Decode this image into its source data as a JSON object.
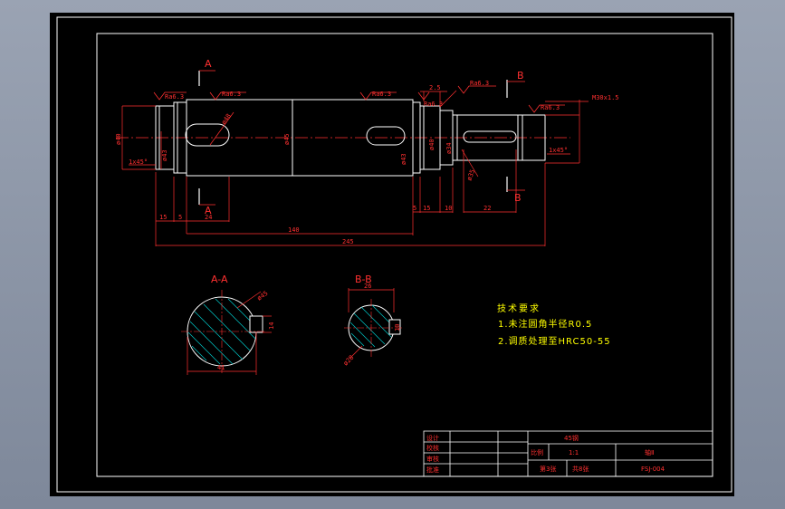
{
  "colors": {
    "background": "#000000",
    "frame": "#ffffff",
    "dimension": "#ff3030",
    "notes": "#ffff00",
    "centerline": "#ff3030",
    "hatch": "#00c8c8"
  },
  "section_labels": {
    "a": "A",
    "a2": "A",
    "b": "B",
    "b2": "B",
    "aa": "A-A",
    "bb": "B-B"
  },
  "roughness": {
    "r1": "Ra6.3",
    "r2": "Ra6.3",
    "r3": "Ra6.3",
    "r4": "Ra6.3",
    "r5": "Ra6.3",
    "r6": "Ra6.3"
  },
  "dimensions": {
    "d40_left": "ø40",
    "d43_left": "ø43",
    "chamfer_left": "1x45°",
    "keyway_left": "ø48",
    "d45": "ø45",
    "d43_right": "ø43",
    "d40_right": "ø40",
    "d34": "ø34",
    "d35": "ø35",
    "chamfer_right": "1x45°",
    "len_15a": "15",
    "len_5a": "5",
    "len_24": "24",
    "len_140": "140",
    "len_245": "245",
    "len_5b": "5",
    "len_15b": "15",
    "len_10": "10",
    "len_22": "22",
    "len_25": "2.5",
    "thread": "M30x1.5",
    "aa_dia": "ø45",
    "aa_14": "14",
    "aa_41": "41",
    "bb_26": "26",
    "bb_10": "10",
    "bb_dia": "ø28"
  },
  "tech_notes": {
    "title": "技术要求",
    "line1": "1.未注圆角半径R0.5",
    "line2": "2.调质处理至HRC50-55"
  },
  "title_block": {
    "material": "45钢",
    "row_design": "设计",
    "row_check": "校核",
    "row_review": "审核",
    "row_approve": "批准",
    "scale_label": "比例",
    "scale_value": "1:1",
    "part_name": "轴Ⅱ",
    "sheet": "第3张",
    "total": "共8张",
    "drawing_no": "FSJ-004"
  }
}
